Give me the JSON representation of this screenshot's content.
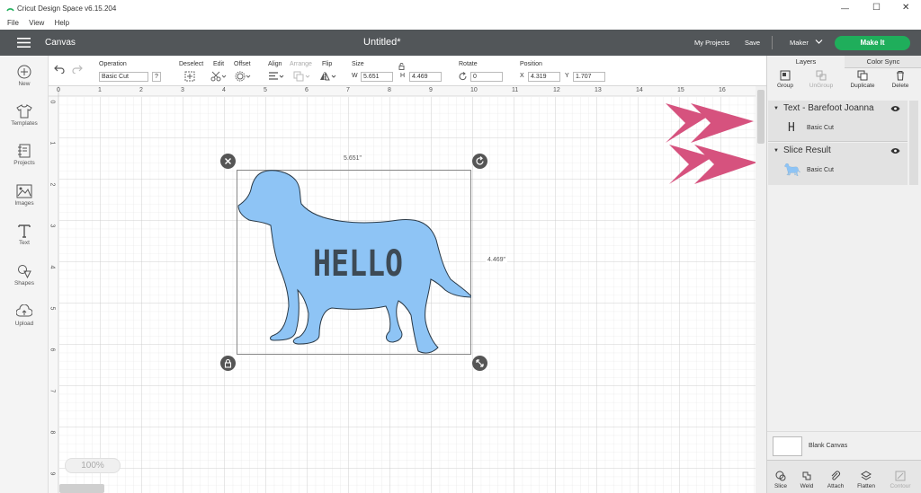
{
  "window": {
    "title": "Cricut Design Space  v6.15.204",
    "min": "—",
    "max": "☐",
    "close": "✕"
  },
  "menu": [
    "File",
    "View",
    "Help"
  ],
  "header": {
    "canvas_label": "Canvas",
    "doc_title": "Untitled*",
    "my_projects": "My Projects",
    "save": "Save",
    "machine": "Maker",
    "make_it": "Make It",
    "accent": "#1fae5b"
  },
  "toolbar": {
    "operation_label": "Operation",
    "operation_value": "Basic Cut",
    "help": "?",
    "deselect": "Deselect",
    "edit": "Edit",
    "offset": "Offset",
    "align": "Align",
    "arrange": "Arrange",
    "flip": "Flip",
    "size": "Size",
    "w_label": "W",
    "w_value": "5.651",
    "h_label": "H",
    "h_value": "4.469",
    "rotate": "Rotate",
    "rotate_value": "0",
    "position": "Position",
    "x_label": "X",
    "x_value": "4.319",
    "y_label": "Y",
    "y_value": "1.707"
  },
  "leftbar": [
    {
      "label": "New",
      "icon": "plus-circle-icon"
    },
    {
      "label": "Templates",
      "icon": "tshirt-icon"
    },
    {
      "label": "Projects",
      "icon": "projects-icon"
    },
    {
      "label": "Images",
      "icon": "image-icon"
    },
    {
      "label": "Text",
      "icon": "text-icon"
    },
    {
      "label": "Shapes",
      "icon": "shapes-icon"
    },
    {
      "label": "Upload",
      "icon": "upload-icon"
    }
  ],
  "ruler": {
    "h_ticks": [
      "0",
      "1",
      "2",
      "3",
      "4",
      "5",
      "6",
      "7",
      "8",
      "9",
      "10",
      "11",
      "12",
      "13",
      "14",
      "15",
      "16",
      "1"
    ],
    "v_ticks": [
      "0",
      "1",
      "2",
      "3",
      "4",
      "5",
      "6",
      "7",
      "8",
      "9"
    ]
  },
  "canvas": {
    "width_label": "5.651\"",
    "height_label": "4.469\"",
    "shape_text": "HELLO",
    "shape_color": "#8ec4f5",
    "zoom": "100%"
  },
  "layers_panel": {
    "tab_layers": "Layers",
    "tab_color_sync": "Color Sync",
    "group": "Group",
    "ungroup": "UnGroup",
    "duplicate": "Duplicate",
    "delete": "Delete",
    "layers": [
      {
        "name": "Text - Barefoot Joanna",
        "sub": "Basic Cut"
      },
      {
        "name": "Slice Result",
        "sub": "Basic Cut"
      }
    ],
    "blank_canvas": "Blank Canvas",
    "bottom": [
      "Slice",
      "Weld",
      "Attach",
      "Flatten",
      "Contour"
    ],
    "arrow_color": "#d6527e"
  }
}
